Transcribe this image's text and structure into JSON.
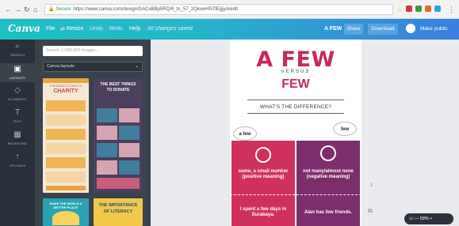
{
  "browser": {
    "url": "https://www.canva.com/design/DACxBBp5RQ/8_to_57_2QkvwHN7tEgjyA/edit",
    "secure_label": "Secure",
    "window_controls": "— ❐ ✕"
  },
  "topbar": {
    "logo": "Canva",
    "menu": [
      "File",
      "Resize",
      "Undo",
      "Redo",
      "Help"
    ],
    "saved": "All changes saved",
    "design_title": "A FEW",
    "share": "Share",
    "download": "Download",
    "make_public": "Make public"
  },
  "rail": [
    {
      "icon": "⌕",
      "label": "SEARCH"
    },
    {
      "icon": "▣",
      "label": "LAYOUTS"
    },
    {
      "icon": "◇",
      "label": "ELEMENTS"
    },
    {
      "icon": "T",
      "label": "TEXT"
    },
    {
      "icon": "▦",
      "label": "BKGROUND"
    },
    {
      "icon": "↑",
      "label": "UPLOADS"
    }
  ],
  "panel": {
    "search_placeholder": "Search 1,000,000 images...",
    "select_value": "Canva layouts",
    "thumb_texts": {
      "charity_small": "5 REASONS TO GIVE TO",
      "charity": "CHARITY",
      "donate_1": "THE BEST THINGS",
      "donate_2": "TO DONATE",
      "make_world": "MAKE THE WORLD A BETTER PLACE",
      "literacy_1": "THE IMPORTANCE",
      "literacy_2": "OF LITERACY"
    }
  },
  "design": {
    "title_1": "A FEW",
    "versus": "VERSUS",
    "title_2": "FEW",
    "question": "WHAT'S THE DIFFERENCE?",
    "bubble_left": "a few",
    "bubble_right": "few",
    "left_meaning": "some, a small number (positive meaning)",
    "right_meaning": "not many/almost none (negative meaning)",
    "left_example": "I spent a few days in Surabaya.",
    "right_example": "Alan has few friends.",
    "colors": {
      "left": "#d0315c",
      "right": "#7c2d6b",
      "title": "#c72a55"
    }
  },
  "workspace": {
    "page_number": "1",
    "zoom": "— 58% +"
  }
}
